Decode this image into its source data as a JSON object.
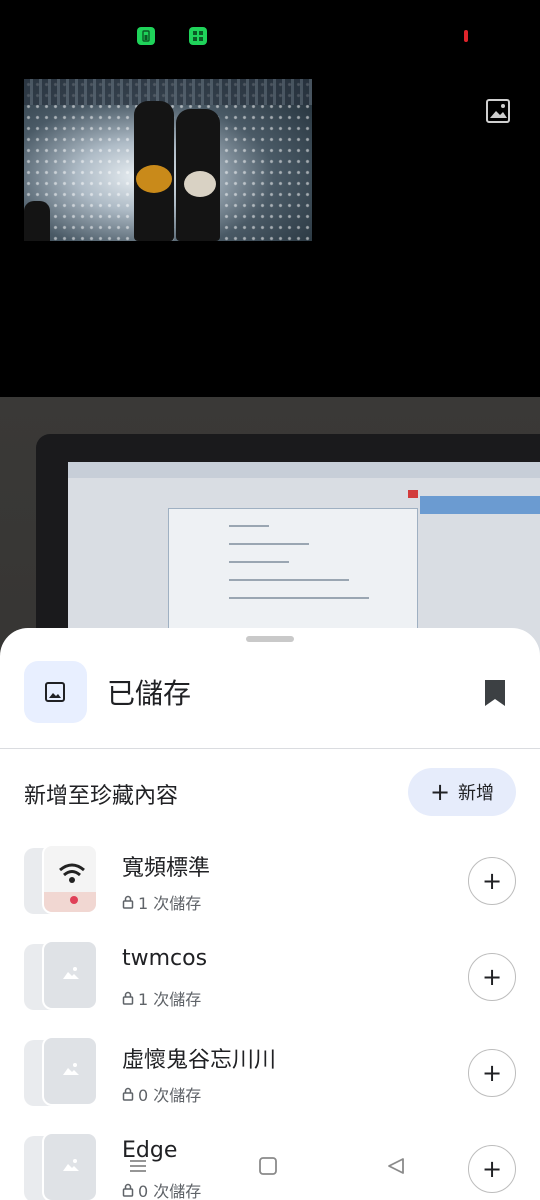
{
  "status_bar": {
    "icons": [
      "battery-saver-icon",
      "grid-icon",
      "recording-indicator"
    ]
  },
  "video": {
    "alt": "concert video thumbnail",
    "search_icon": "image-search-icon"
  },
  "sheet": {
    "header_title": "已儲存",
    "header_icon": "image-icon",
    "bookmark_icon": "bookmark-icon",
    "section_title": "新增至珍藏內容",
    "new_button": "新增",
    "collections": [
      {
        "name": "寬頻標準",
        "saves": "1 次儲存",
        "thumbnail": "wifi-photo"
      },
      {
        "name": "twmcos",
        "saves": "1 次儲存",
        "thumbnail": "placeholder"
      },
      {
        "name": "虛懷鬼谷忘川川",
        "saves": "0 次儲存",
        "thumbnail": "placeholder"
      },
      {
        "name": "Edge",
        "saves": "0 次儲存",
        "thumbnail": "placeholder"
      }
    ]
  },
  "nav_bar": {
    "buttons": [
      "menu-icon",
      "home-icon",
      "back-icon"
    ]
  },
  "colors": {
    "accent_soft": "#e6ecfb",
    "status_green": "#1fd35a",
    "record_red": "#e0242b"
  }
}
